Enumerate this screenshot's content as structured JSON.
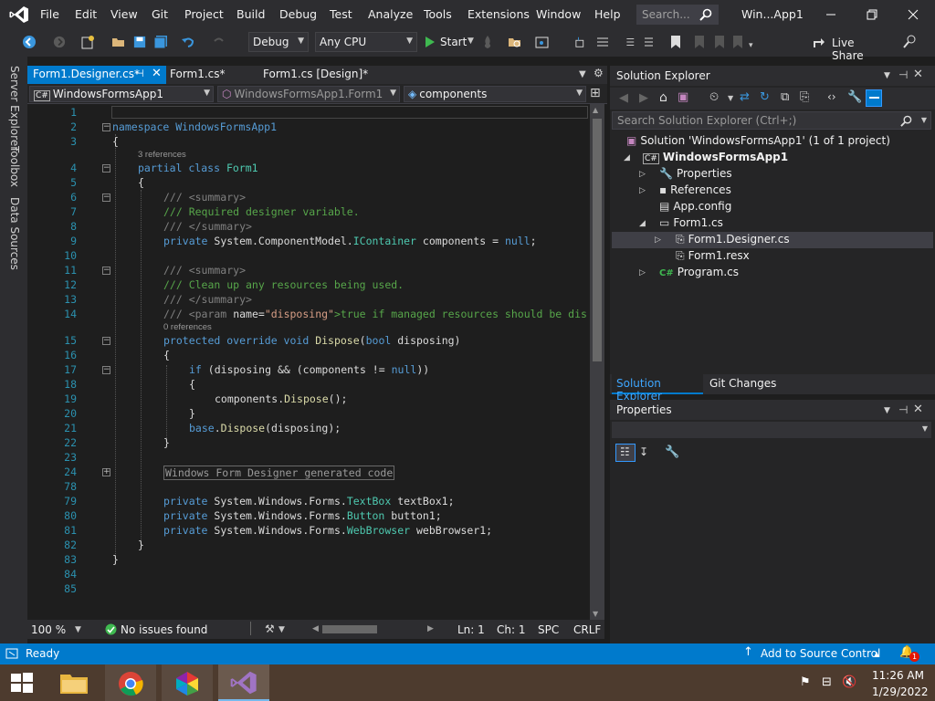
{
  "titlebar": {
    "menu": [
      "File",
      "Edit",
      "View",
      "Git",
      "Project",
      "Build",
      "Debug",
      "Test",
      "Analyze",
      "Tools",
      "Extensions",
      "Window",
      "Help"
    ],
    "search_placeholder": "Search...",
    "window_title": "Win...App1"
  },
  "toolbar": {
    "config": "Debug",
    "platform": "Any CPU",
    "start_label": "Start",
    "live_share": "Live Share"
  },
  "left_strip": {
    "tabs": [
      "Server Explorer",
      "Toolbox",
      "Data Sources"
    ]
  },
  "doc_tabs": [
    {
      "label": "Form1.Designer.cs*",
      "active": true
    },
    {
      "label": "Form1.cs*",
      "active": false
    },
    {
      "label": "Form1.cs [Design]*",
      "active": false
    }
  ],
  "navbar": {
    "project": "WindowsFormsApp1",
    "class": "WindowsFormsApp1.Form1",
    "member": "components"
  },
  "code": {
    "refs_3": "3 references",
    "refs_0": "0 references",
    "l2": "namespace WindowsFormsApp1",
    "l4_kw": "partial class",
    "l4_name": "Form1",
    "summary_open": "/// <summary>",
    "l7": "/// Required designer variable.",
    "summary_close": "/// </summary>",
    "l9_kw": "private",
    "l9_ns": "System.ComponentModel.",
    "l9_type": "IContainer",
    "l9_mid": "components =",
    "l9_null": "null",
    "l12": "/// Clean up any resources being used.",
    "l14_a": "/// <param",
    "l14_b": "name=",
    "l14_c": "\"disposing\"",
    "l14_d": ">true if managed resources should be dis",
    "l15_kw": "protected override void",
    "l15_mt": "Dispose",
    "l15_p1": "(",
    "l15_kw2": "bool",
    "l15_p2": "disposing)",
    "l17_kw": "if",
    "l17_rest": "(disposing && (components !=",
    "l17_null": "null",
    "l17_end": "))",
    "l19_obj": "components.",
    "l19_mt": "Dispose",
    "l19_end": "();",
    "l21_kw": "base",
    "l21_dot": ".",
    "l21_mt": "Dispose",
    "l21_end": "(disposing);",
    "l24": "Windows Form Designer generated code",
    "priv": "private",
    "swf": "System.Windows.Forms.",
    "l79_type": "TextBox",
    "l79_name": "textBox1;",
    "l80_type": "Button",
    "l80_name": "button1;",
    "l81_type": "WebBrowser",
    "l81_name": "webBrowser1;",
    "line_numbers": [
      "1",
      "2",
      "3",
      "4",
      "5",
      "6",
      "7",
      "8",
      "9",
      "10",
      "11",
      "12",
      "13",
      "14",
      "15",
      "16",
      "17",
      "18",
      "19",
      "20",
      "21",
      "22",
      "23",
      "24",
      "78",
      "79",
      "80",
      "81",
      "82",
      "83",
      "84",
      "85"
    ]
  },
  "editor_status": {
    "zoom": "100 %",
    "issues": "No issues found",
    "line": "Ln: 1",
    "col": "Ch: 1",
    "spc": "SPC",
    "eol": "CRLF"
  },
  "solution_explorer": {
    "title": "Solution Explorer",
    "search_placeholder": "Search Solution Explorer (Ctrl+;)",
    "solution": "Solution 'WindowsFormsApp1' (1 of 1 project)",
    "project": "WindowsFormsApp1",
    "items": [
      "Properties",
      "References",
      "App.config",
      "Form1.cs",
      "Form1.Designer.cs",
      "Form1.resx",
      "Program.cs"
    ],
    "bottom_tabs": [
      "Solution Explorer",
      "Git Changes"
    ]
  },
  "properties": {
    "title": "Properties"
  },
  "statusbar": {
    "ready": "Ready",
    "source_control": "Add to Source Control",
    "notifications": "1"
  },
  "taskbar": {
    "time": "11:26 AM",
    "date": "1/29/2022"
  },
  "colors": {
    "accent": "#007acc",
    "keyword": "#569cd6",
    "comment": "#57a64a",
    "type": "#4ec9b0",
    "string": "#d69d85"
  }
}
